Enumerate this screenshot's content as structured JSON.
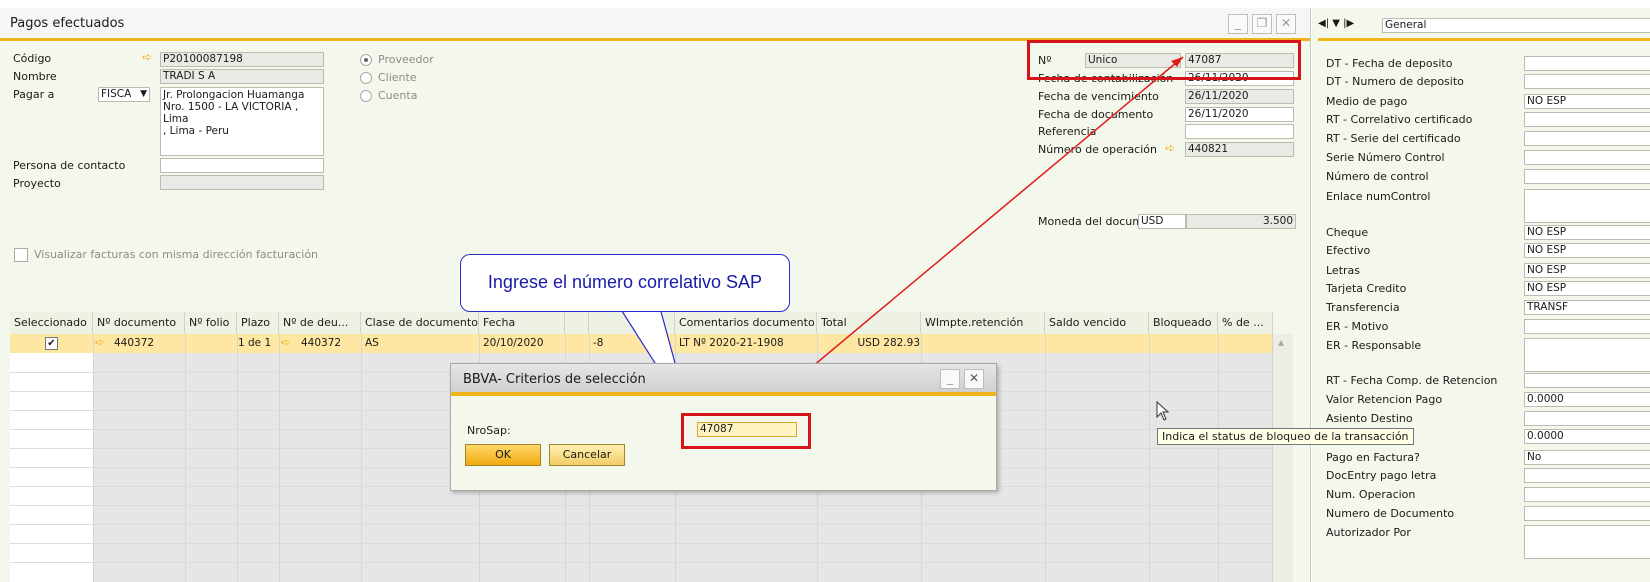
{
  "window": {
    "title": "Pagos efectuados"
  },
  "header": {
    "codigo_label": "Código",
    "codigo_value": "P20100087198",
    "nombre_label": "Nombre",
    "nombre_value": "TRADI S A",
    "pagar_label": "Pagar a",
    "pagar_select": "FISCA",
    "address_lines": [
      "Jr. Prolongacion Huamanga",
      "Nro. 1500 - LA VICTORIA ,",
      "Lima",
      " , Lima - Peru"
    ],
    "contacto_label": "Persona de contacto",
    "proyecto_label": "Proyecto",
    "radio_proveedor": "Proveedor",
    "radio_cliente": "Cliente",
    "radio_cuenta": "Cuenta",
    "checkbox_label": "Visualizar facturas con misma dirección facturación"
  },
  "docinfo": {
    "no_label": "Nº",
    "series": "Unico",
    "number": "47087",
    "fecha_cont_label": "Fecha de contabilización",
    "fecha_cont": "26/11/2020",
    "fecha_venc_label": "Fecha de vencimiento",
    "fecha_venc": "26/11/2020",
    "fecha_doc_label": "Fecha de documento",
    "fecha_doc": "26/11/2020",
    "referencia_label": "Referencia",
    "num_op_label": "Número de operación",
    "num_op": "440821",
    "moneda_label": "Moneda del docum",
    "moneda": "USD",
    "tipo_cambio": "3.500"
  },
  "grid": {
    "headers": [
      "Seleccionado",
      "Nº documento",
      "Nº folio",
      "Plazo",
      "Nº de deu...",
      "Clase de documento",
      "Fecha",
      "",
      "",
      "Comentarios documento",
      "Total",
      "WImpte.retención",
      "Saldo vencido",
      "Bloqueado",
      "% de ..."
    ],
    "row": {
      "doc": "440372",
      "plazo": "1 de 1",
      "deu": "440372",
      "clase": "AS",
      "fecha": "20/10/2020",
      "dias": "-8",
      "comentario": "LT Nº 2020-21-1908",
      "total": "USD 282.93"
    }
  },
  "callout": {
    "text": "Ingrese el número correlativo SAP"
  },
  "dialog": {
    "title": "BBVA- Criterios de selección",
    "field_label": "NroSap:",
    "field_value": "47087",
    "ok": "OK",
    "cancel": "Cancelar"
  },
  "tooltip": {
    "text": "Indica el status de bloqueo de la transacción"
  },
  "rightpanel": {
    "tab": "General",
    "rows": [
      {
        "label": "DT - Fecha de deposito",
        "value": ""
      },
      {
        "label": "DT - Numero de deposito",
        "value": ""
      },
      {
        "label": "Medio de pago",
        "value": "NO ESP"
      },
      {
        "label": "RT - Correlativo certificado",
        "value": ""
      },
      {
        "label": "RT - Serie del certificado",
        "value": ""
      },
      {
        "label": "Serie Número Control",
        "value": ""
      },
      {
        "label": "Número de control",
        "value": ""
      },
      {
        "label": "Enlace numControl",
        "value": ""
      },
      {
        "label": "Cheque",
        "value": "NO ESP"
      },
      {
        "label": "Efectivo",
        "value": "NO ESP"
      },
      {
        "label": "Letras",
        "value": "NO ESP"
      },
      {
        "label": "Tarjeta Credito",
        "value": "NO ESP"
      },
      {
        "label": "Transferencia",
        "value": "TRANSF"
      },
      {
        "label": "ER - Motivo",
        "value": ""
      },
      {
        "label": "ER - Responsable",
        "value": ""
      },
      {
        "label": "RT - Fecha Comp. de Retencion",
        "value": ""
      },
      {
        "label": "Valor Retencion Pago",
        "value": "0.0000"
      },
      {
        "label": "Asiento Destino",
        "value": ""
      },
      {
        "label": "",
        "value": "0.0000"
      },
      {
        "label": "Pago en Factura?",
        "value": "No"
      },
      {
        "label": "DocEntry pago letra",
        "value": ""
      },
      {
        "label": "Num. Operacion",
        "value": ""
      },
      {
        "label": "Numero de Documento",
        "value": ""
      },
      {
        "label": "Autorizador Por",
        "value": ""
      }
    ]
  }
}
